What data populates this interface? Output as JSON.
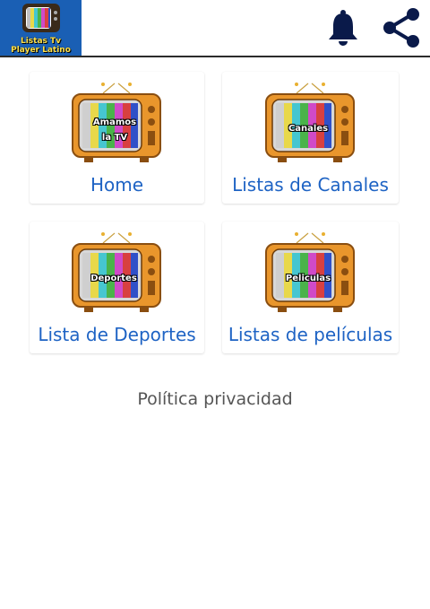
{
  "app": {
    "logo_line1": "Listas Tv",
    "logo_line2": "Player Latino"
  },
  "header": {
    "icons": [
      "bell-icon",
      "share-icon"
    ]
  },
  "menu": {
    "items": [
      {
        "label": "Home",
        "tv_caption_1": "Amamos",
        "tv_caption_2": "la TV"
      },
      {
        "label": "Listas de Canales",
        "tv_caption_1": "Canales"
      },
      {
        "label": "Lista de Deportes",
        "tv_caption_1": "Deportes"
      },
      {
        "label": "Listas de películas",
        "tv_caption_1": "Peliculas"
      }
    ]
  },
  "footer": {
    "privacy_link": "Política privacidad"
  },
  "colors": {
    "accent": "#1e63c4",
    "tv_body": "#e9962c",
    "logo_bg": "#1a5fb4"
  }
}
